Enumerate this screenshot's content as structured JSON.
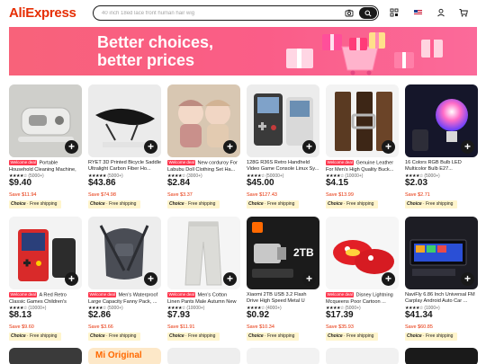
{
  "header": {
    "logo": "AliExpress",
    "search_placeholder": "40 inch 18ed lace front human hair wig"
  },
  "banner": {
    "line1": "Better choices,",
    "line2": "better prices"
  },
  "colors": {
    "brand": "#e62e04",
    "banner": "#f8627a",
    "choice_bg": "#fff5cc",
    "badge": "#fd384f"
  },
  "products": [
    {
      "badge": "Welcome deal",
      "title": "Portable Household Cleaning Machine, 450m...",
      "rating": "★★★★☆",
      "sold": "(5000+)",
      "price": "$9.40",
      "save": "Save $11.94",
      "choice": "Choice",
      "shipping": "Free shipping",
      "img_color": "#d9d9d6"
    },
    {
      "badge": "",
      "title": "RYET 3D Printed Bicycle Saddle Ultralight Carbon Fiber Ho...",
      "rating": "★★★★★",
      "sold": "(5000+)",
      "price": "$43.86",
      "save": "Save $74.98",
      "choice": "Choice",
      "shipping": "Free shipping",
      "img_color": "#e9e9e9"
    },
    {
      "badge": "Welcome deal",
      "title": "New corduroy For Labubu Doll Clothing Set Ha...",
      "rating": "★★★★☆",
      "sold": "(3000+)",
      "price": "$2.84",
      "save": "Save $3.37",
      "choice": "Choice",
      "shipping": "Free shipping",
      "img_color": "#c9b5a0"
    },
    {
      "badge": "",
      "title": "128G R36S Retro Handheld Video Game Console Linux Sy...",
      "rating": "★★★★☆",
      "sold": "(50000+)",
      "price": "$45.00",
      "save": "Save $127.43",
      "choice": "Choice",
      "shipping": "Free shipping",
      "img_color": "#e8e8e8"
    },
    {
      "badge": "Welcome deal",
      "title": "Genuine Leather For Men's High Quality Buck...",
      "rating": "★★★★☆",
      "sold": "(10000+)",
      "price": "$4.15",
      "save": "Save $13.99",
      "choice": "Choice",
      "shipping": "Free shipping",
      "img_color": "#2a2a2a"
    },
    {
      "badge": "",
      "title": "16 Colors RGB Bulb LED Multicolor Bulb E27...",
      "rating": "★★★★☆",
      "sold": "(5000+)",
      "price": "$2.03",
      "save": "Save $2.71",
      "choice": "Choice",
      "shipping": "Free shipping",
      "img_color": "#1a1a2e"
    },
    {
      "badge": "Welcome deal",
      "title": "A Red Retro Classic Games Children's Handhel...",
      "rating": "★★★★☆",
      "sold": "(10000+)",
      "price": "$8.13",
      "save": "Save $9.60",
      "choice": "Choice",
      "shipping": "Free shipping",
      "img_color": "#f2f2f2"
    },
    {
      "badge": "Welcome deal",
      "title": "Men's Waterproof Large Capacity Fanny Pack, ...",
      "rating": "★★★★☆",
      "sold": "(5000+)",
      "price": "$2.86",
      "save": "Save $3.66",
      "choice": "Choice",
      "shipping": "Free shipping",
      "img_color": "#ececec"
    },
    {
      "badge": "Welcome deal",
      "title": "Men's Cotton Linen Pants Male Autumn New ...",
      "rating": "★★★★☆",
      "sold": "(10000+)",
      "price": "$7.93",
      "save": "Save $11.91",
      "choice": "Choice",
      "shipping": "Free shipping",
      "img_color": "#f4f4f4"
    },
    {
      "badge": "",
      "title": "Xiaomi 2TB USB 3.2 Flash Drive High Speed Metal U Disk...",
      "rating": "★★★★☆",
      "sold": "(4000+)",
      "price": "$0.92",
      "save": "Save $10.34",
      "choice": "Choice",
      "shipping": "Free shipping",
      "img_color": "#1b1b1b"
    },
    {
      "badge": "Welcome deal",
      "title": "Disney Lightning Mcqueens Poor Cartoon ...",
      "rating": "★★★★☆",
      "sold": "(5000+)",
      "price": "$17.39",
      "save": "Save $35.93",
      "choice": "Choice",
      "shipping": "Free shipping",
      "img_color": "#f6f6f6"
    },
    {
      "badge": "",
      "title": "NaviFly 6.86 Inch Universal FM Carplay Android Auto Car ...",
      "rating": "★★★★☆",
      "sold": "(1000+)",
      "price": "$41.34",
      "save": "Save $60.85",
      "choice": "Choice",
      "shipping": "Free shipping",
      "img_color": "#1d1d24"
    }
  ],
  "row3": [
    {
      "img_color": "#3a3a3a",
      "text": ""
    },
    {
      "img_color": "#fde8c8",
      "text": "Mi Original"
    },
    {
      "img_color": "#eeeeee",
      "text": ""
    },
    {
      "img_color": "#f2f2f2",
      "text": ""
    },
    {
      "img_color": "#f1f1f1",
      "text": ""
    },
    {
      "img_color": "#1a1a1a",
      "text": ""
    }
  ]
}
